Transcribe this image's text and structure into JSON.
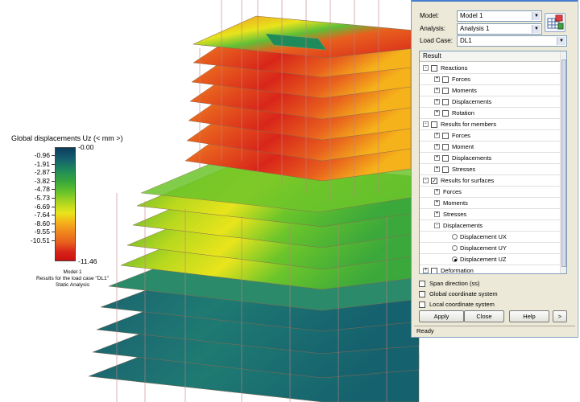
{
  "legend": {
    "title": "Global displacements Uz (< mm >)",
    "max_label": "-0.00",
    "min_label": "-11.46",
    "values": [
      "-0.96",
      "-1.91",
      "-2.87",
      "-3.82",
      "-4.78",
      "-5.73",
      "-6.69",
      "-7.64",
      "-8.60",
      "-9.55",
      "-10.51"
    ],
    "caption_line1": "Model 1",
    "caption_line2": "Results for the load case \"DL1\"",
    "caption_line3": "Static Analysis"
  },
  "panel": {
    "model_label": "Model:",
    "model_value": "Model 1",
    "analysis_label": "Analysis:",
    "analysis_value": "Analysis 1",
    "loadcase_label": "Load Case:",
    "loadcase_value": "DL1",
    "tree_header": "Result",
    "tree": [
      {
        "label": "Reactions",
        "level": 0,
        "expand": "-",
        "check": false
      },
      {
        "label": "Forces",
        "level": 1,
        "expand": "+",
        "check": false
      },
      {
        "label": "Moments",
        "level": 1,
        "expand": "+",
        "check": false
      },
      {
        "label": "Displacements",
        "level": 1,
        "expand": "+",
        "check": false
      },
      {
        "label": "Rotation",
        "level": 1,
        "expand": "+",
        "check": false
      },
      {
        "label": "Results for members",
        "level": 0,
        "expand": "-",
        "check": false
      },
      {
        "label": "Forces",
        "level": 1,
        "expand": "+",
        "check": false
      },
      {
        "label": "Moment",
        "level": 1,
        "expand": "+",
        "check": false
      },
      {
        "label": "Displacements",
        "level": 1,
        "expand": "+",
        "check": false
      },
      {
        "label": "Stresses",
        "level": 1,
        "expand": "+",
        "check": false
      },
      {
        "label": "Results for surfaces",
        "level": 0,
        "expand": "-",
        "check": true
      },
      {
        "label": "Forces",
        "level": 1,
        "expand": "+",
        "check": null
      },
      {
        "label": "Moments",
        "level": 1,
        "expand": "+",
        "check": null
      },
      {
        "label": "Stresses",
        "level": 1,
        "expand": "+",
        "check": null
      },
      {
        "label": "Displacements",
        "level": 1,
        "expand": "-",
        "check": null
      },
      {
        "label": "Displacement UX",
        "level": 2,
        "radio": false
      },
      {
        "label": "Displacement UY",
        "level": 2,
        "radio": false
      },
      {
        "label": "Displacement UZ",
        "level": 2,
        "radio": true
      },
      {
        "label": "Deformation",
        "level": 0,
        "expand": "+",
        "check": false
      }
    ],
    "options": [
      {
        "label": "Span direction (ss)",
        "checked": false
      },
      {
        "label": "Global coordinate system",
        "checked": false
      },
      {
        "label": "Local coordinate system",
        "checked": false
      }
    ],
    "buttons": {
      "apply": "Apply",
      "close": "Close",
      "help": "Help",
      "more": ">"
    },
    "status": "Ready"
  }
}
